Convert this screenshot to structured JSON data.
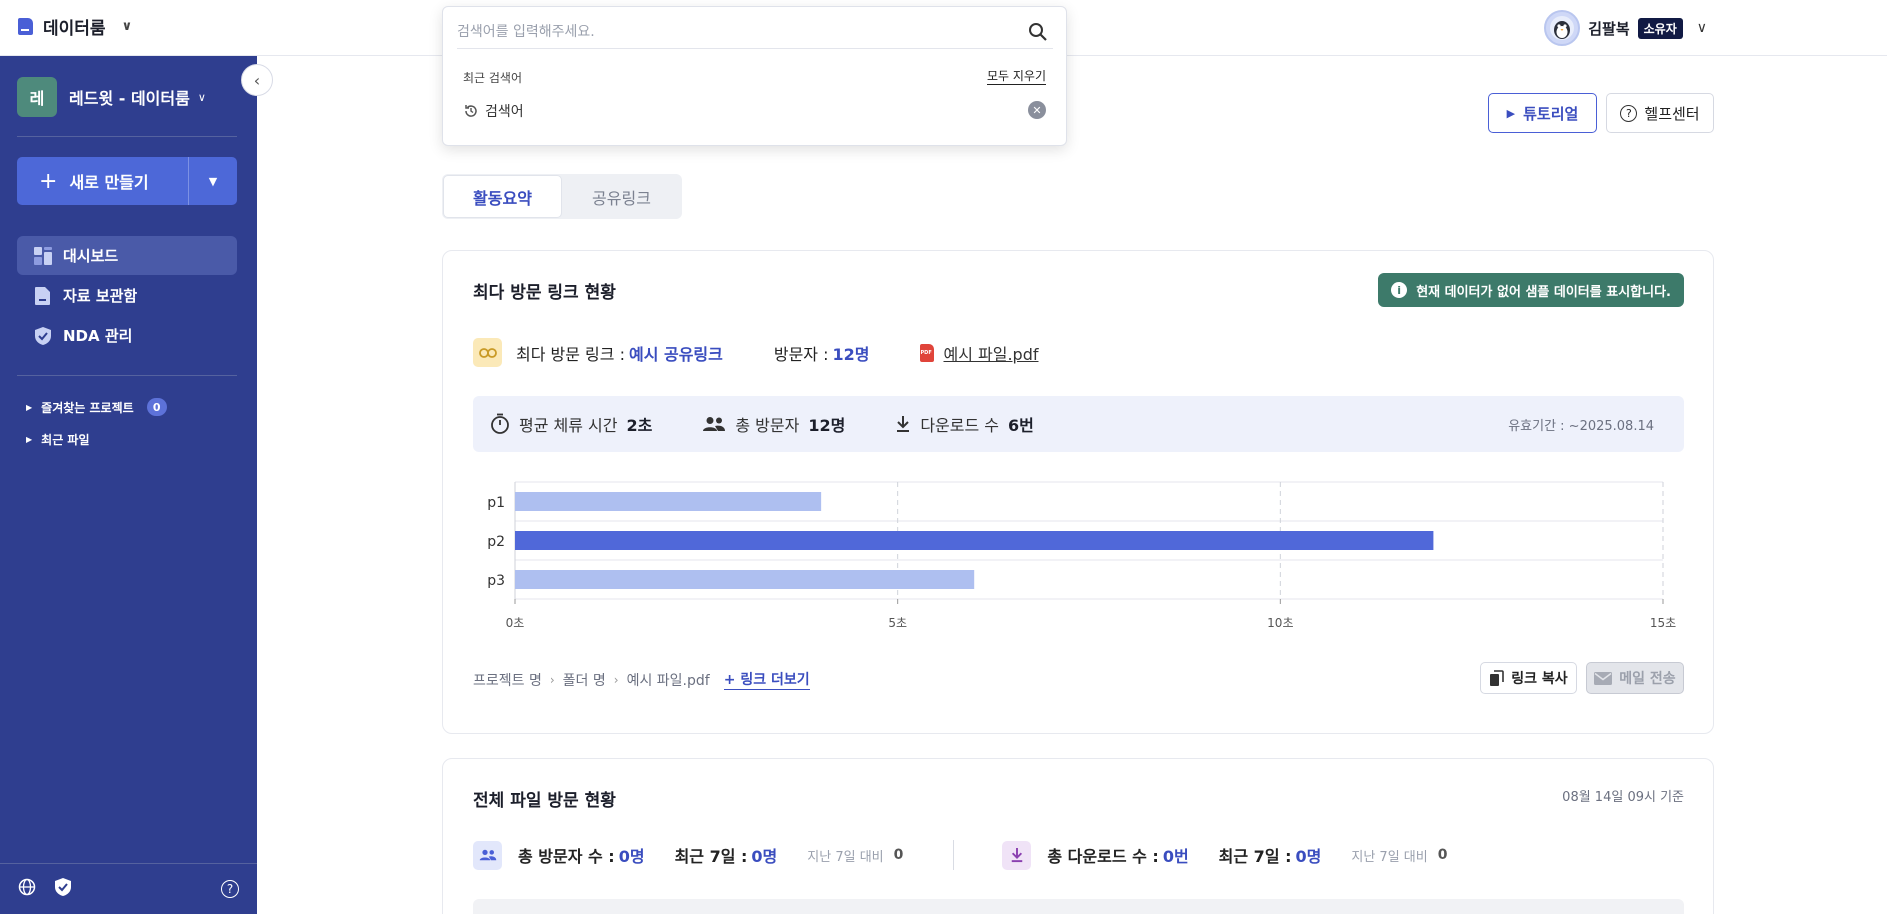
{
  "topbar": {
    "brand": "데이터룸",
    "user_name": "김팔복",
    "user_badge": "소유자"
  },
  "sidebar": {
    "workspace_initial": "레",
    "workspace_name": "레드윗 - 데이터룸",
    "new_button": "새로 만들기",
    "items": [
      {
        "label": "대시보드",
        "icon": "dashboard-icon",
        "active": true
      },
      {
        "label": "자료 보관함",
        "icon": "folder-icon",
        "active": false
      },
      {
        "label": "NDA 관리",
        "icon": "shield-icon",
        "active": false
      }
    ],
    "favorites_label": "즐겨찾는 프로젝트",
    "favorites_count": "0",
    "recent_files_label": "최근 파일"
  },
  "search": {
    "placeholder": "검색어를 입력해주세요.",
    "recent_title": "최근 검색어",
    "clear_all": "모두 지우기",
    "recent_items": [
      "검색어"
    ]
  },
  "header_buttons": {
    "tutorial": "튜토리얼",
    "help_center": "헬프센터"
  },
  "tabs": [
    {
      "label": "활동요약",
      "active": true
    },
    {
      "label": "공유링크",
      "active": false
    }
  ],
  "top_link_card": {
    "title": "최다 방문 링크 현황",
    "sample_note": "현재 데이터가 없어 샘플 데이터를 표시합니다.",
    "top_link_label": "최다 방문 링크 :",
    "top_link_value": "예시 공유링크",
    "visitors_label": "방문자 :",
    "visitors_value": "12명",
    "file_name": "예시 파일.pdf",
    "avg_stay_label": "평균 체류 시간",
    "avg_stay_value": "2초",
    "total_visitors_label": "총 방문자",
    "total_visitors_value": "12명",
    "downloads_label": "다운로드 수",
    "downloads_value": "6번",
    "validity": "유효기간 : ~2025.08.14",
    "breadcrumb": [
      "프로젝트 명",
      "폴더 명",
      "예시 파일.pdf"
    ],
    "more_link": "링크 더보기",
    "copy_link": "링크 복사",
    "send_mail": "메일 전송"
  },
  "chart_data": {
    "type": "bar",
    "orientation": "horizontal",
    "categories": [
      "p1",
      "p2",
      "p3"
    ],
    "values": [
      4,
      12,
      6
    ],
    "highlight_index": 1,
    "xlim": [
      0,
      15
    ],
    "xticks": [
      0,
      5,
      10,
      15
    ],
    "xtick_labels": [
      "0초",
      "5초",
      "10초",
      "15초"
    ],
    "colors": {
      "normal": "#aebff0",
      "highlight": "#5068d9"
    },
    "grid": true
  },
  "all_files_card": {
    "title": "전체 파일 방문 현황",
    "as_of": "08월 14일 09시 기준",
    "total_visitors_label": "총 방문자 수 :",
    "total_visitors_value": "0명",
    "recent7_label": "최근 7일 :",
    "recent7_visitors_value": "0명",
    "compare_label": "지난 7일 대비",
    "compare_visitors_value": "0",
    "total_downloads_label": "총 다운로드 수 :",
    "total_downloads_value": "0번",
    "recent7_downloads_value": "0명",
    "compare_downloads_value": "0"
  }
}
